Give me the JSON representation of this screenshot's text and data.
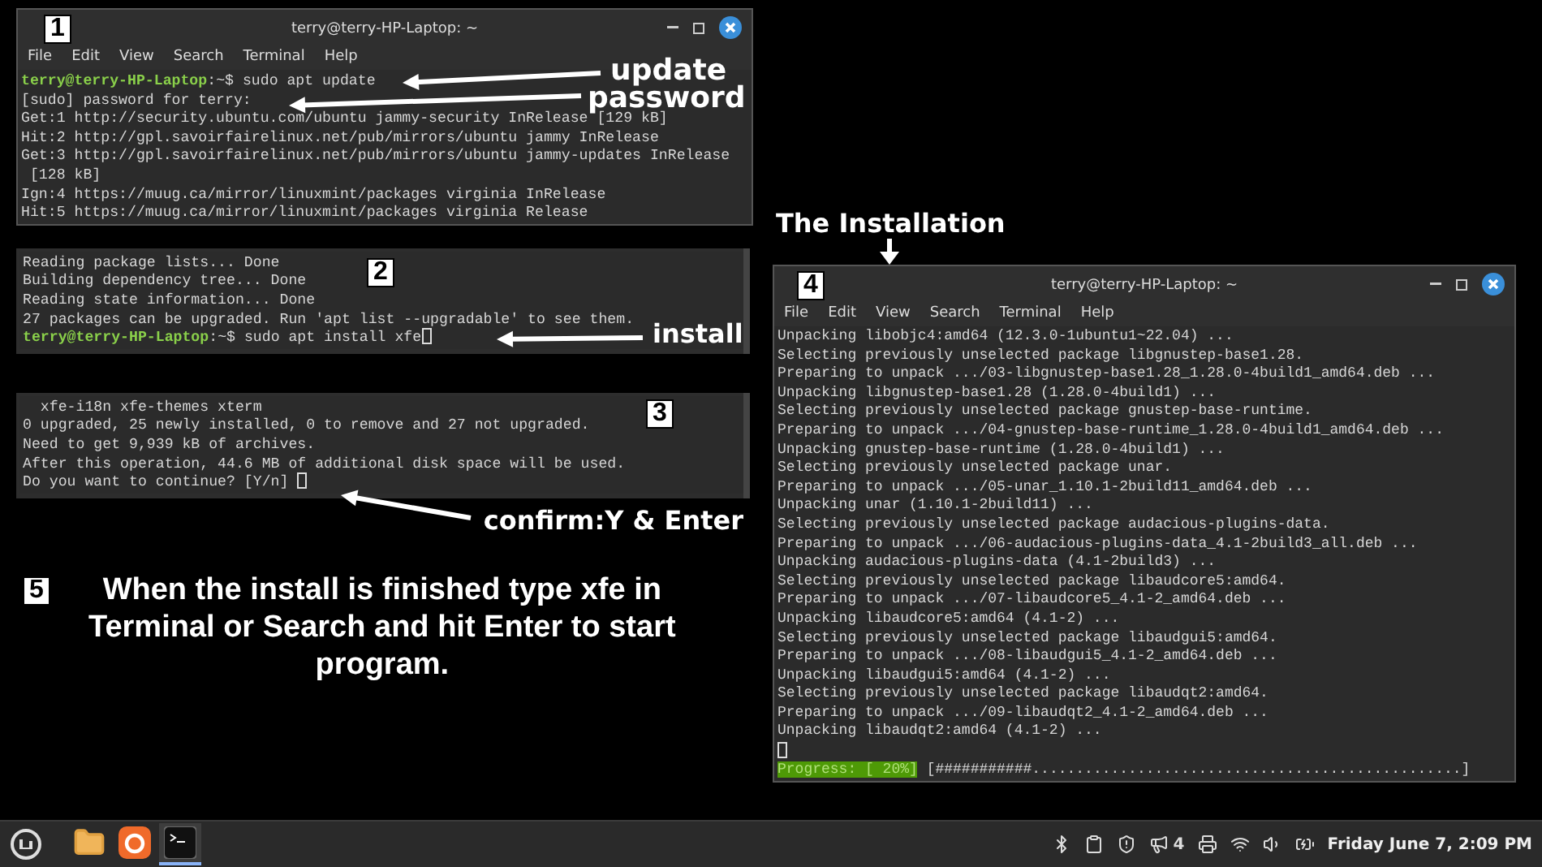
{
  "step1": {
    "badge": "1",
    "title": "terry@terry-HP-Laptop: ~",
    "menu": [
      "File",
      "Edit",
      "View",
      "Search",
      "Terminal",
      "Help"
    ],
    "lines": [
      {
        "kind": "prompt",
        "user": "terry@terry-HP-Laptop",
        "path": ":~$",
        "command": " sudo apt update",
        "cursor": false
      },
      {
        "kind": "text",
        "text": "[sudo] password for terry:"
      },
      {
        "kind": "text",
        "text": "Get:1 http://security.ubuntu.com/ubuntu jammy-security InRelease [129 kB]"
      },
      {
        "kind": "text",
        "text": "Hit:2 http://gpl.savoirfairelinux.net/pub/mirrors/ubuntu jammy InRelease"
      },
      {
        "kind": "text",
        "text": "Get:3 http://gpl.savoirfairelinux.net/pub/mirrors/ubuntu jammy-updates InRelease"
      },
      {
        "kind": "text",
        "text": " [128 kB]"
      },
      {
        "kind": "text",
        "text": "Ign:4 https://muug.ca/mirror/linuxmint/packages virginia InRelease"
      },
      {
        "kind": "text",
        "text": "Hit:5 https://muug.ca/mirror/linuxmint/packages virginia Release"
      }
    ],
    "callouts": [
      "update",
      "password"
    ]
  },
  "step2": {
    "badge": "2",
    "lines": [
      {
        "kind": "text",
        "text": "Reading package lists... Done"
      },
      {
        "kind": "text",
        "text": "Building dependency tree... Done"
      },
      {
        "kind": "text",
        "text": "Reading state information... Done"
      },
      {
        "kind": "text",
        "text": "27 packages can be upgraded. Run 'apt list --upgradable' to see them."
      },
      {
        "kind": "prompt",
        "user": "terry@terry-HP-Laptop",
        "path": ":~$",
        "command": " sudo apt install xfe",
        "cursor": true
      }
    ],
    "callout": "install"
  },
  "step3": {
    "badge": "3",
    "lines": [
      {
        "kind": "text",
        "text": "  xfe-i18n xfe-themes xterm"
      },
      {
        "kind": "text",
        "text": "0 upgraded, 25 newly installed, 0 to remove and 27 not upgraded."
      },
      {
        "kind": "text",
        "text": "Need to get 9,939 kB of archives."
      },
      {
        "kind": "text",
        "text": "After this operation, 44.6 MB of additional disk space will be used."
      },
      {
        "kind": "prompt",
        "command": "Do you want to continue? [Y/n] ",
        "cursor": true
      }
    ],
    "callout": "confirm:Y & Enter"
  },
  "step5": {
    "badge": "5",
    "text": "When the install is finished type xfe in Terminal or Search and hit Enter to start program."
  },
  "installation": {
    "heading": "The Installation",
    "badge": "4",
    "title": "terry@terry-HP-Laptop: ~",
    "menu": [
      "File",
      "Edit",
      "View",
      "Search",
      "Terminal",
      "Help"
    ],
    "lines": [
      {
        "kind": "text",
        "text": "Unpacking libobjc4:amd64 (12.3.0-1ubuntu1~22.04) ..."
      },
      {
        "kind": "text",
        "text": "Selecting previously unselected package libgnustep-base1.28."
      },
      {
        "kind": "text",
        "text": "Preparing to unpack .../03-libgnustep-base1.28_1.28.0-4build1_amd64.deb ..."
      },
      {
        "kind": "text",
        "text": "Unpacking libgnustep-base1.28 (1.28.0-4build1) ..."
      },
      {
        "kind": "text",
        "text": "Selecting previously unselected package gnustep-base-runtime."
      },
      {
        "kind": "text",
        "text": "Preparing to unpack .../04-gnustep-base-runtime_1.28.0-4build1_amd64.deb ..."
      },
      {
        "kind": "text",
        "text": "Unpacking gnustep-base-runtime (1.28.0-4build1) ..."
      },
      {
        "kind": "text",
        "text": "Selecting previously unselected package unar."
      },
      {
        "kind": "text",
        "text": "Preparing to unpack .../05-unar_1.10.1-2build11_amd64.deb ..."
      },
      {
        "kind": "text",
        "text": "Unpacking unar (1.10.1-2build11) ..."
      },
      {
        "kind": "text",
        "text": "Selecting previously unselected package audacious-plugins-data."
      },
      {
        "kind": "text",
        "text": "Preparing to unpack .../06-audacious-plugins-data_4.1-2build3_all.deb ..."
      },
      {
        "kind": "text",
        "text": "Unpacking audacious-plugins-data (4.1-2build3) ..."
      },
      {
        "kind": "text",
        "text": "Selecting previously unselected package libaudcore5:amd64."
      },
      {
        "kind": "text",
        "text": "Preparing to unpack .../07-libaudcore5_4.1-2_amd64.deb ..."
      },
      {
        "kind": "text",
        "text": "Unpacking libaudcore5:amd64 (4.1-2) ..."
      },
      {
        "kind": "text",
        "text": "Selecting previously unselected package libaudgui5:amd64."
      },
      {
        "kind": "text",
        "text": "Preparing to unpack .../08-libaudgui5_4.1-2_amd64.deb ..."
      },
      {
        "kind": "text",
        "text": "Unpacking libaudgui5:amd64 (4.1-2) ..."
      },
      {
        "kind": "text",
        "text": "Selecting previously unselected package libaudqt2:amd64."
      },
      {
        "kind": "text",
        "text": "Preparing to unpack .../09-libaudqt2_4.1-2_amd64.deb ..."
      },
      {
        "kind": "text",
        "text": "Unpacking libaudqt2:amd64 (4.1-2) ..."
      },
      {
        "kind": "prompt",
        "cursor": true
      },
      {
        "kind": "progress",
        "label": "Progress: [ 20%]",
        "bar": "[###########.................................................]"
      }
    ]
  },
  "taskbar": {
    "apps": [
      {
        "kind": "folder",
        "selected": false
      },
      {
        "kind": "browser",
        "selected": false
      },
      {
        "kind": "terminal",
        "selected": true
      }
    ],
    "notification_count": "4",
    "clock": "Friday June  7, 2:09 PM"
  }
}
